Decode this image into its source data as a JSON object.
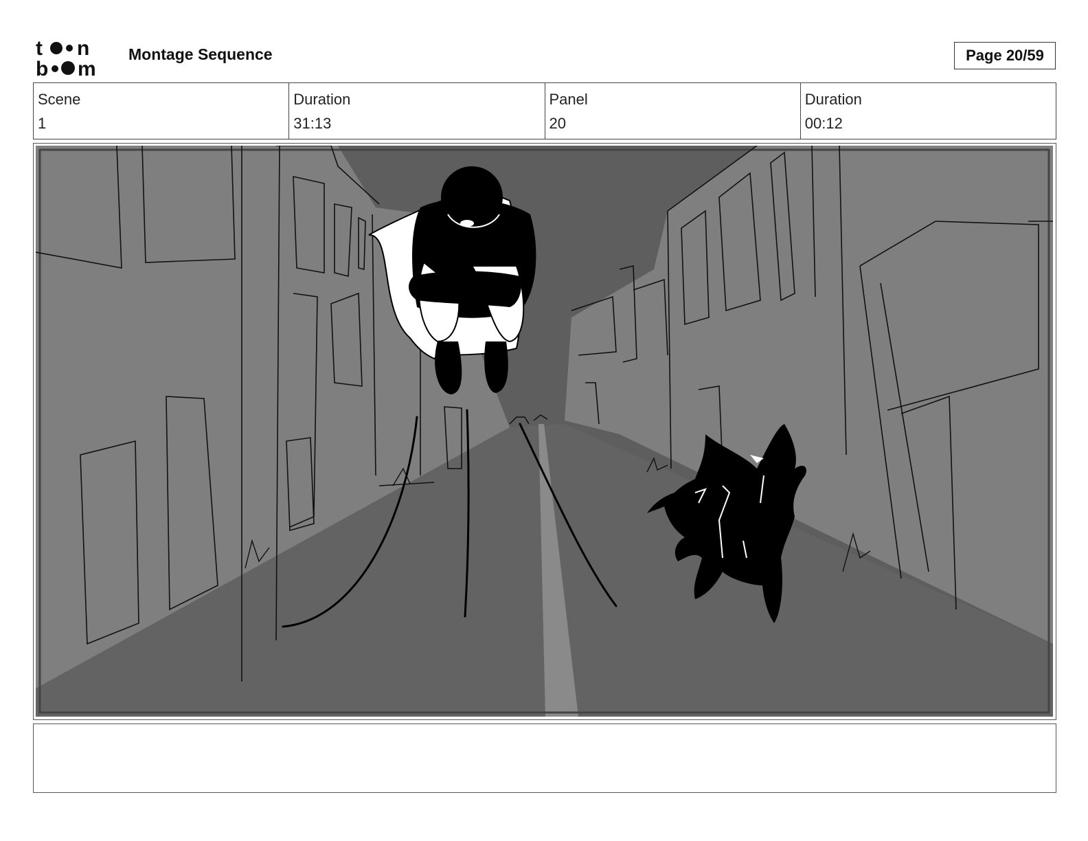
{
  "header": {
    "logo_top": "to●n",
    "logo_bottom": "b●●m",
    "title": "Montage Sequence",
    "page": "Page 20/59"
  },
  "info": [
    {
      "label": "Scene",
      "value": "1"
    },
    {
      "label": "Duration",
      "value": "31:13"
    },
    {
      "label": "Panel",
      "value": "20"
    },
    {
      "label": "Duration",
      "value": "00:12"
    }
  ],
  "panel": {
    "sky_color": "#5e5e5e",
    "building_color": "#7f7f7f",
    "road_color": "#636363",
    "ink_color": "#000000"
  },
  "notes": ""
}
